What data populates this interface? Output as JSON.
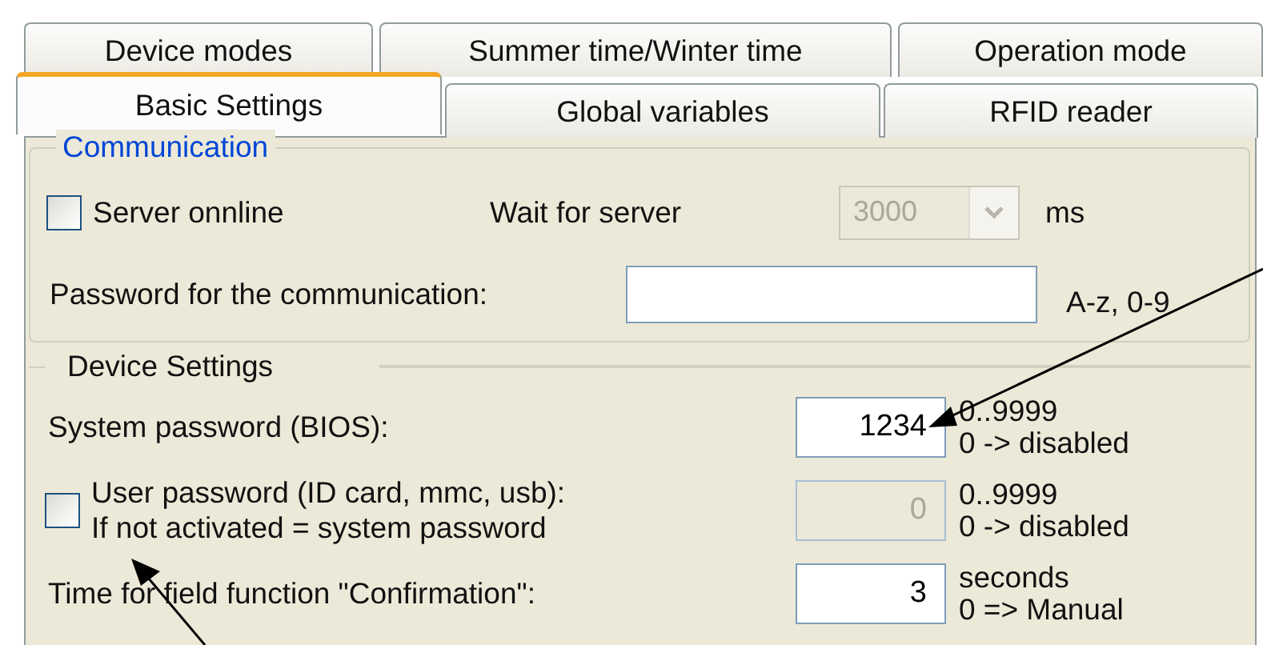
{
  "tabs": {
    "row_1": [
      {
        "label": "Device modes",
        "selected": false
      },
      {
        "label": "Summer time/Winter time",
        "selected": false
      },
      {
        "label": "Operation mode",
        "selected": false
      }
    ],
    "row_2": [
      {
        "label": "Basic Settings",
        "selected": true
      },
      {
        "label": "Global variables",
        "selected": false
      },
      {
        "label": "RFID reader",
        "selected": false
      }
    ]
  },
  "communication": {
    "title": "Communication",
    "server_online": {
      "label": "Server onnline",
      "checked": false
    },
    "wait_label": "Wait for server",
    "wait_value": "3000",
    "wait_disabled": true,
    "wait_unit": "ms",
    "password_label": "Password for the communication:",
    "password_hint": "A-z, 0-9"
  },
  "device_settings": {
    "title": "Device Settings",
    "rows": [
      {
        "kind": "field",
        "label": "System password (BIOS):",
        "value": "1234",
        "disabled": false,
        "hint": [
          "0..9999",
          "0 -> disabled"
        ]
      },
      {
        "kind": "checkbox",
        "label": "User password (ID card, mmc, usb):",
        "label_2": "If not activated = system password",
        "checked": false,
        "value": "0",
        "disabled": true,
        "hint": [
          "0..9999",
          "0 -> disabled"
        ]
      },
      {
        "kind": "field",
        "label": "Time for field function \"Confirmation\":",
        "value": "3",
        "disabled": false,
        "hint": [
          "seconds",
          "0 => Manual"
        ]
      }
    ]
  }
}
